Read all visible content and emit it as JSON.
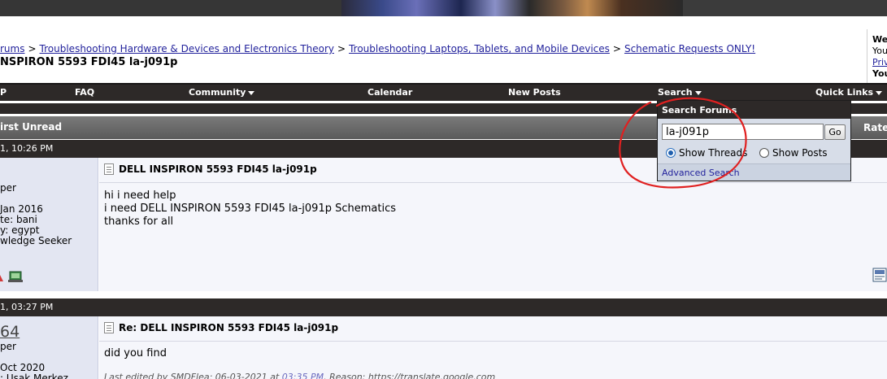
{
  "breadcrumb": [
    {
      "label": "rums"
    },
    {
      "label": "Troubleshooting Hardware & Devices and Electronics Theory"
    },
    {
      "label": "Troubleshooting Laptops, Tablets, and Mobile Devices"
    },
    {
      "label": "Schematic Requests ONLY!"
    }
  ],
  "breadcrumb_separator": ">",
  "thread_title": "NSPIRON 5593 FDI45 la-j091p",
  "userbox": {
    "line1": "We",
    "line2": "You",
    "line3": "Priv",
    "line4": "You"
  },
  "menu": {
    "item_p": "P",
    "faq": "FAQ",
    "community": "Community",
    "calendar": "Calendar",
    "new_posts": "New Posts",
    "search": "Search",
    "quick_links": "Quick Links"
  },
  "thread_header": {
    "label": "irst Unread",
    "rate": "Rate"
  },
  "search_popup": {
    "title": "Search Forums",
    "query": "la-j091p",
    "go": "Go",
    "show_threads": "Show Threads",
    "show_posts": "Show Posts",
    "selected": "threads",
    "advanced": "Advanced Search"
  },
  "posts": [
    {
      "date": "1, 10:26 PM",
      "user": {
        "line1": "per",
        "line2": "Jan 2016",
        "line3": "te: bani",
        "line4": "y: egypt",
        "line5": "wledge Seeker"
      },
      "title": "DELL INSPIRON 5593 FDI45 la-j091p",
      "lines": [
        "hi i need help",
        "i need DELL INSPIRON 5593 FDI45 la-j091p Schematics",
        "thanks for all"
      ]
    },
    {
      "date": "1, 03:27 PM",
      "user": {
        "name": "64",
        "line1": "per",
        "line2": "Oct 2020",
        "line3": ": Uşak Merkez"
      },
      "title": "Re: DELL INSPIRON 5593 FDI45 la-j091p",
      "lines": [
        "did you find"
      ],
      "edit_prefix": "Last edited by SMDFlea; 06-03-2021 at ",
      "edit_time": "03:35 PM",
      "edit_suffix": ". Reason: https://translate.google.com"
    }
  ],
  "colors": {
    "annotation": "#e02020",
    "menubar": "#2d2928",
    "link": "#22229c"
  }
}
